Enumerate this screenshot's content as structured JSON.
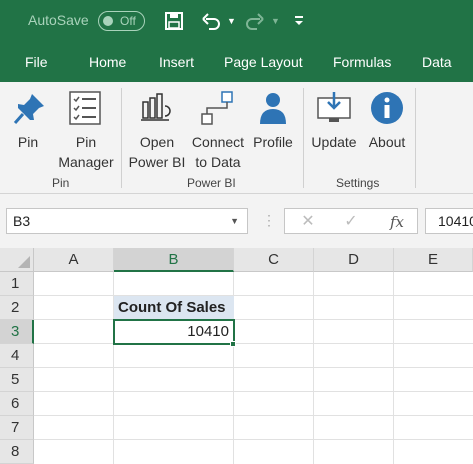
{
  "quick_access": {
    "autosave_label": "AutoSave",
    "autosave_state": "Off"
  },
  "tabs": [
    "File",
    "Home",
    "Insert",
    "Page Layout",
    "Formulas",
    "Data"
  ],
  "ribbon": {
    "groups": [
      {
        "label": "Pin",
        "buttons": [
          {
            "line1": "Pin",
            "line2": ""
          },
          {
            "line1": "Pin",
            "line2": "Manager"
          }
        ]
      },
      {
        "label": "Power BI",
        "buttons": [
          {
            "line1": "Open",
            "line2": "Power BI"
          },
          {
            "line1": "Connect",
            "line2": "to Data"
          },
          {
            "line1": "Profile",
            "line2": ""
          }
        ]
      },
      {
        "label": "Settings",
        "buttons": [
          {
            "line1": "Update",
            "line2": ""
          },
          {
            "line1": "About",
            "line2": ""
          }
        ]
      }
    ]
  },
  "formula_bar": {
    "name_box": "B3",
    "fx_label": "fx",
    "value": "10410"
  },
  "sheet": {
    "columns": [
      "A",
      "B",
      "C",
      "D",
      "E"
    ],
    "rows": [
      "1",
      "2",
      "3",
      "4",
      "5",
      "6",
      "7",
      "8"
    ],
    "selected_column": "B",
    "selected_row": "3",
    "cells": {
      "B2": "Count Of Sales",
      "B3": "10410"
    }
  },
  "colors": {
    "brand": "#217346",
    "ribbon_bg": "#f3f3f3",
    "header_cell_fill": "#dce6f1",
    "icon_blue": "#2e74b5"
  }
}
